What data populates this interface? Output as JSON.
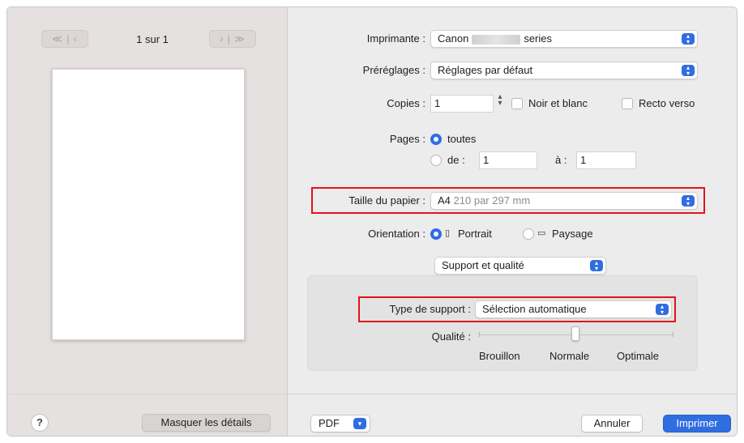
{
  "preview": {
    "first_prev_label": "≪ | ‹",
    "next_last_label": "› | ≫",
    "page_counter": "1 sur 1",
    "help_label": "?",
    "hide_details_label": "Masquer les détails"
  },
  "printer": {
    "label": "Imprimante :",
    "value_prefix": "Canon",
    "value_suffix": "series"
  },
  "presets": {
    "label": "Préréglages :",
    "value": "Réglages par défaut"
  },
  "copies": {
    "label": "Copies :",
    "value": "1",
    "bw_label": "Noir et blanc",
    "duplex_label": "Recto verso"
  },
  "pages": {
    "label": "Pages :",
    "all_label": "toutes",
    "from_label": "de :",
    "from_value": "1",
    "to_label": "à :",
    "to_value": "1"
  },
  "paper_size": {
    "label": "Taille du papier :",
    "value": "A4",
    "detail": "210 par 297 mm"
  },
  "orientation": {
    "label": "Orientation :",
    "portrait_label": "Portrait",
    "landscape_label": "Paysage"
  },
  "section_popup": {
    "value": "Support et qualité"
  },
  "media_type": {
    "label": "Type de support :",
    "value": "Sélection automatique"
  },
  "quality": {
    "label": "Qualité :",
    "draft_label": "Brouillon",
    "normal_label": "Normale",
    "best_label": "Optimale",
    "level": "Normale"
  },
  "footer": {
    "pdf_label": "PDF",
    "cancel_label": "Annuler",
    "print_label": "Imprimer"
  },
  "colors": {
    "accent": "#2f6de1",
    "highlight_border": "#e0141c"
  },
  "icons": [
    "popup-arrows-icon",
    "stepper-arrows-icon",
    "portrait-icon",
    "landscape-icon",
    "chevron-down-icon",
    "help-icon"
  ]
}
